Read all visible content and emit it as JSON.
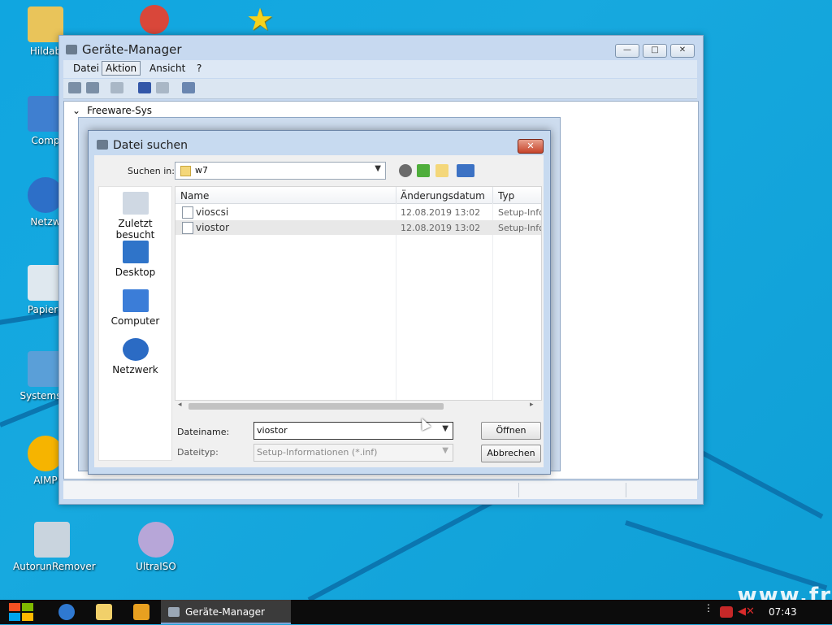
{
  "desktop": {
    "icons": [
      {
        "label": "Hildab",
        "color": "#e9c45a"
      },
      {
        "label": "Comp",
        "color": "#3f7fd0"
      },
      {
        "label": "Netzw",
        "color": "#2d6fc8"
      },
      {
        "label": "Papierk",
        "color": "#dfe8ef"
      },
      {
        "label": "Systemste",
        "color": "#5a9fd8"
      },
      {
        "label": "AIMP",
        "color": "#f6b400"
      },
      {
        "label": "AutorunRemover",
        "color": "#c9d4de"
      },
      {
        "label": "UltraISO",
        "color": "#b7a6d8"
      }
    ],
    "watermark": "www.fr"
  },
  "device_manager": {
    "title": "Geräte-Manager",
    "menu": [
      "Datei",
      "Aktion",
      "Ansicht",
      "?"
    ],
    "active_menu": "Aktion",
    "window_buttons": {
      "minimize": "—",
      "maximize": "□",
      "close": "✕"
    },
    "tree_root": "Freeware-Sys"
  },
  "dialog": {
    "title": "Datei suchen",
    "close_label": "✕",
    "look_in_label": "Suchen in:",
    "look_in_value": "w7",
    "places": [
      "Zuletzt besucht",
      "Desktop",
      "Computer",
      "Netzwerk"
    ],
    "columns": [
      "Name",
      "Änderungsdatum",
      "Typ"
    ],
    "files": [
      {
        "name": "vioscsi",
        "date": "12.08.2019 13:02",
        "type": "Setup-Info"
      },
      {
        "name": "viostor",
        "date": "12.08.2019 13:02",
        "type": "Setup-Info"
      }
    ],
    "filename_label": "Dateiname:",
    "filename_value": "viostor",
    "filetype_label": "Dateityp:",
    "filetype_value": "Setup-Informationen (*.inf)",
    "open_button": "Öffnen",
    "cancel_button": "Abbrechen"
  },
  "taskbar": {
    "active_task": "Geräte-Manager",
    "clock": "07:43"
  }
}
